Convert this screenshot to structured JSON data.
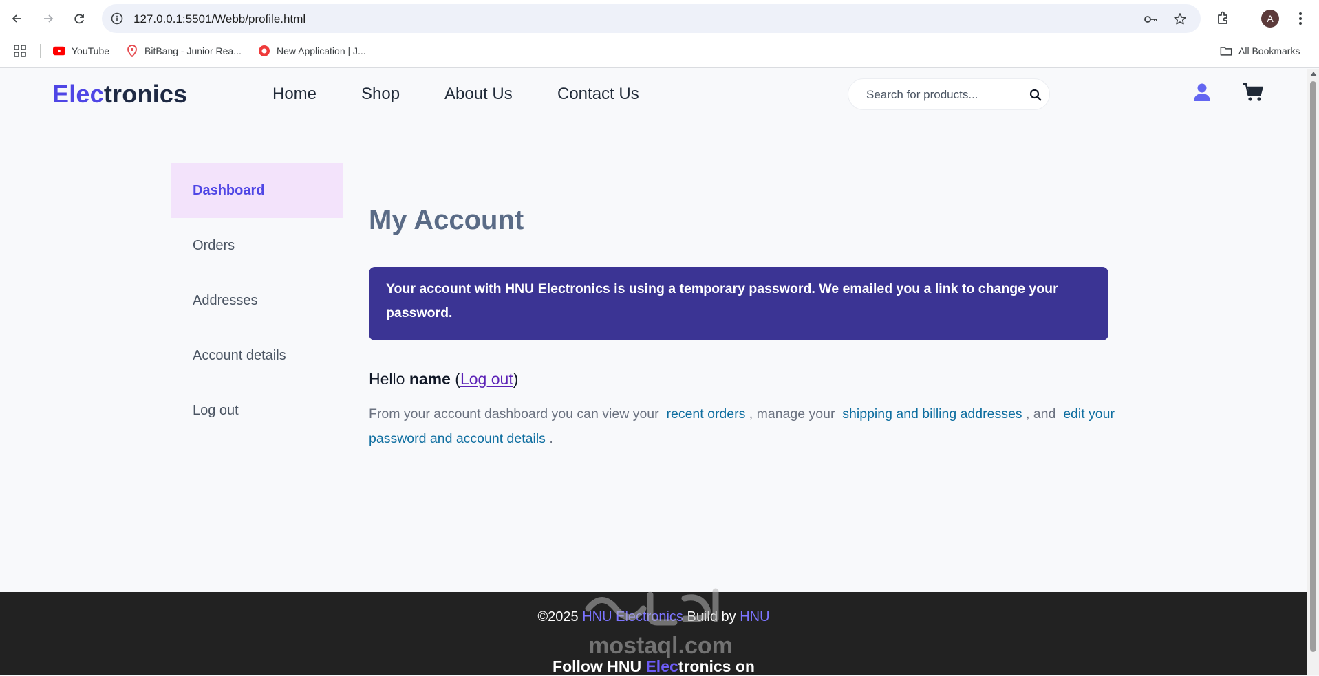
{
  "browser": {
    "url": "127.0.0.1:5501/Webb/profile.html",
    "profile_initial": "A",
    "bookmarks": [
      {
        "label": "YouTube",
        "icon": "youtube-icon"
      },
      {
        "label": "BitBang - Junior Rea...",
        "icon": "location-pin-icon"
      },
      {
        "label": "New Application | J...",
        "icon": "record-icon"
      }
    ],
    "all_bookmarks": "All Bookmarks"
  },
  "header": {
    "logo_accent": "Elec",
    "logo_rest": "tronics",
    "nav": [
      "Home",
      "Shop",
      "About Us",
      "Contact Us"
    ],
    "search_placeholder": "Search for products..."
  },
  "sidebar": {
    "items": [
      {
        "label": "Dashboard",
        "active": true
      },
      {
        "label": "Orders",
        "active": false
      },
      {
        "label": "Addresses",
        "active": false
      },
      {
        "label": "Account details",
        "active": false
      },
      {
        "label": "Log out",
        "active": false
      }
    ]
  },
  "main": {
    "title": "My Account",
    "notice": "Your account with HNU Electronics is using a temporary password. We emailed you a link to change your password.",
    "hello_prefix": "Hello",
    "hello_name": "name",
    "logout_link": "Log out",
    "dashboard_intro": "From your account dashboard you can view your",
    "link_recent_orders": "recent orders",
    "manage_text": ", manage your",
    "link_addresses": "shipping and billing addresses",
    "and_text": ", and",
    "link_account": "edit your password and account details",
    "end_text": "."
  },
  "footer": {
    "copyright_prefix": "©2025",
    "brand": "HNU Electronics",
    "built_by": "Build by",
    "author": "HNU",
    "follow_prefix": "Follow HNU",
    "follow_accent": "Elec",
    "follow_suffix": "tronics on",
    "watermark_text": "mostaql.com"
  },
  "colors": {
    "accent": "#4f46e5",
    "notice_bg": "#3b3494",
    "active_sidebar_bg": "#f3e3fb",
    "link": "#0e6ea0",
    "footer_bg": "#222222"
  }
}
